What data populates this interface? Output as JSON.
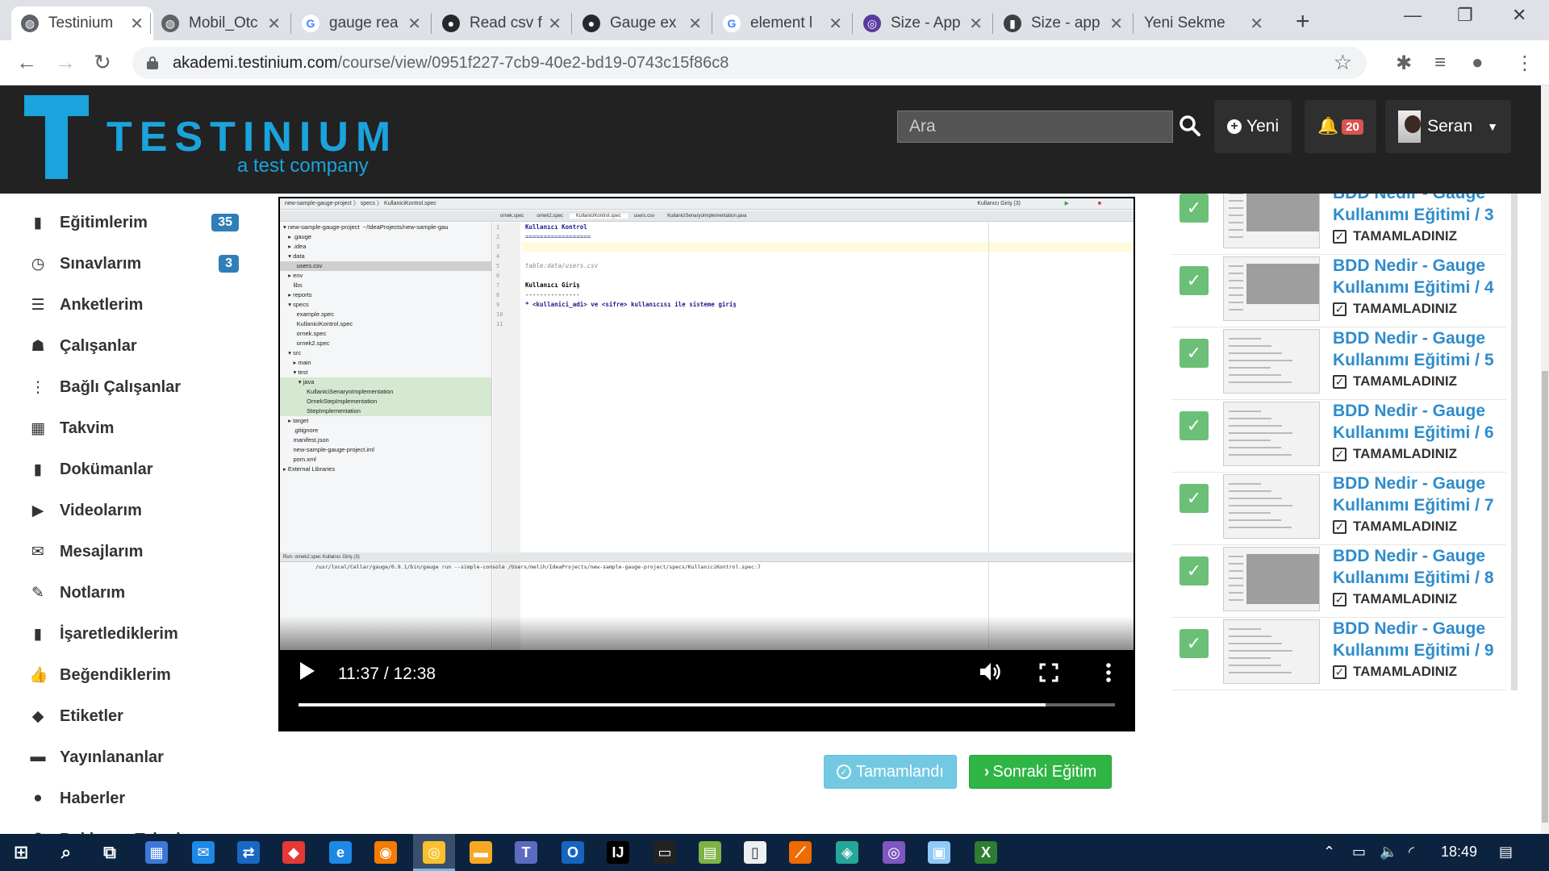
{
  "browser": {
    "tabs": [
      {
        "label": "Testinium",
        "active": true
      },
      {
        "label": "Mobil_Otc"
      },
      {
        "label": "gauge rea"
      },
      {
        "label": "Read csv f"
      },
      {
        "label": "Gauge ex"
      },
      {
        "label": "element l"
      },
      {
        "label": "Size - App"
      },
      {
        "label": "Size - app"
      },
      {
        "label": "Yeni Sekme"
      }
    ],
    "url_host": "akademi.testinium.com",
    "url_path": "/course/view/0951f227-7cb9-40e2-bd19-0743c15f86c8"
  },
  "header": {
    "logo_text": "TESTINIUM",
    "logo_sub": "a test company",
    "search_placeholder": "Ara",
    "new_label": "Yeni",
    "notifications": "20",
    "user_name": "Seran"
  },
  "sidebar": {
    "items": [
      {
        "label": "Eğitimlerim",
        "count": "35",
        "icon": "book-icon",
        "glyph": "▮"
      },
      {
        "label": "Sınavlarım",
        "count": "3",
        "icon": "clock-icon",
        "glyph": "◷"
      },
      {
        "label": "Anketlerim",
        "icon": "list-icon",
        "glyph": "☰"
      },
      {
        "label": "Çalışanlar",
        "icon": "users-icon",
        "glyph": "☗"
      },
      {
        "label": "Bağlı Çalışanlar",
        "icon": "sitemap-icon",
        "glyph": "⋮"
      },
      {
        "label": "Takvim",
        "icon": "calendar-icon",
        "glyph": "▦"
      },
      {
        "label": "Dokümanlar",
        "icon": "file-icon",
        "glyph": "▮"
      },
      {
        "label": "Videolarım",
        "icon": "play-icon",
        "glyph": "▶"
      },
      {
        "label": "Mesajlarım",
        "icon": "envelope-icon",
        "glyph": "✉"
      },
      {
        "label": "Notlarım",
        "icon": "pencil-icon",
        "glyph": "✎"
      },
      {
        "label": "İşaretlediklerim",
        "icon": "bookmark-icon",
        "glyph": "▮"
      },
      {
        "label": "Beğendiklerim",
        "icon": "thumbs-up-icon",
        "glyph": "👍"
      },
      {
        "label": "Etiketler",
        "icon": "tag-icon",
        "glyph": "◆"
      },
      {
        "label": "Yayınlananlar",
        "icon": "comment-icon",
        "glyph": "▬"
      },
      {
        "label": "Haberler",
        "icon": "globe-icon",
        "glyph": "●"
      },
      {
        "label": "Bekleyen Talepler",
        "icon": "question-icon",
        "glyph": "?"
      }
    ]
  },
  "video": {
    "time": "11:37 / 12:38",
    "progress": 0.915,
    "ide": {
      "breadcrumb": "new-sample-gauge-project  〉 specs  〉 KullaniciKontrol.spec",
      "run_config": "Kullanıcı Giriş (3)",
      "tabs": [
        "ornek.spec",
        "ornek2.spec",
        "KullaniciKontrol.spec",
        "users.csv",
        "KullaniciSenaryoImplementation.java"
      ],
      "tree": [
        "▾ new-sample-gauge-project  ~/IdeaProjects/new-sample-gau",
        "   ▸ .gauge",
        "   ▸ .idea",
        "   ▾ data",
        "        users.csv",
        "   ▸ env",
        "      libs",
        "   ▸ reports",
        "   ▾ specs",
        "        example.spec",
        "        KullaniciKontrol.spec",
        "        ornek.spec",
        "        ornek2.spec",
        "   ▾ src",
        "      ▸ main",
        "      ▾ test",
        "         ▾ java",
        "              KullaniciSenaryoImplementation",
        "              OrnekStepImplementation",
        "              StepImplementation",
        "   ▸ target",
        "      .gitignore",
        "      manifest.json",
        "      new-sample-gauge-project.iml",
        "      pom.xml",
        "▸ External Libraries"
      ],
      "lines": [
        "1",
        "2",
        "3",
        "4",
        "5",
        "6",
        "7",
        "8",
        "9",
        "10",
        "11"
      ],
      "code": [
        "Kullanıcı Kontrol",
        "==================",
        "",
        "",
        "table:data/users.csv",
        "",
        "Kullanıcı Giriş",
        "---------------",
        "* <kullanici_adi> ve <sifre> kullanıcısı ile sisteme giriş",
        "",
        ""
      ],
      "run_tabs": "Run:   ornek2.spec     Kullanıcı Giriş (3)",
      "run_cmd": "/usr/local/Cellar/gauge/0.9.1/bin/gauge run --simple-console /Users/melih/IdeaProjects/new-sample-gauge-project/specs/KullaniciKontrol.spec:7"
    }
  },
  "actions": {
    "done_label": "Tamamlandı",
    "next_label": "Sonraki Eğitim"
  },
  "playlist": {
    "status_label": "TAMAMLADINIZ",
    "items": [
      {
        "title_1": "BDD Nedir - Gauge",
        "title_2": "Kullanımı Eğitimi / 3"
      },
      {
        "title_1": "BDD Nedir - Gauge",
        "title_2": "Kullanımı Eğitimi / 4"
      },
      {
        "title_1": "BDD Nedir - Gauge",
        "title_2": "Kullanımı Eğitimi / 5"
      },
      {
        "title_1": "BDD Nedir - Gauge",
        "title_2": "Kullanımı Eğitimi / 6"
      },
      {
        "title_1": "BDD Nedir - Gauge",
        "title_2": "Kullanımı Eğitimi / 7"
      },
      {
        "title_1": "BDD Nedir - Gauge",
        "title_2": "Kullanımı Eğitimi / 8"
      },
      {
        "title_1": "BDD Nedir - Gauge",
        "title_2": "Kullanımı Eğitimi / 9"
      }
    ]
  },
  "taskbar": {
    "time": "18:49"
  },
  "colors": {
    "brand": "#1aa3dc",
    "header_bg": "#222222",
    "link": "#2e8ccc",
    "success": "#2fb544",
    "info": "#5bc0de",
    "badge": "#2e7eb7",
    "taskbar": "#0c2340"
  }
}
